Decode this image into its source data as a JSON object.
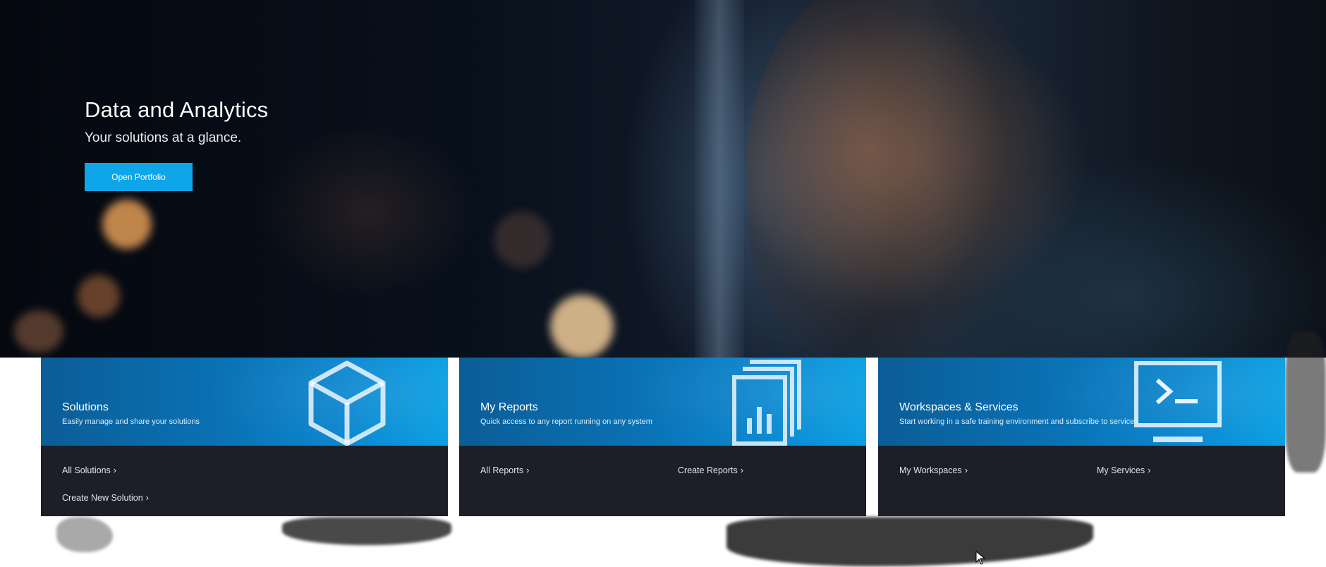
{
  "hero": {
    "title": "Data and Analytics",
    "subtitle": "Your solutions at a glance.",
    "button_label": "Open Portfolio"
  },
  "cards": [
    {
      "title": "Solutions",
      "description": "Easily manage and share your solutions",
      "icon": "cube-icon",
      "links": [
        "All Solutions",
        "Create New Solution"
      ]
    },
    {
      "title": "My Reports",
      "description": "Quick access to any report running on any system",
      "icon": "report-stack-icon",
      "links": [
        "All Reports",
        "Create Reports"
      ]
    },
    {
      "title": "Workspaces & Services",
      "description": "Start working in a safe training environment and subscribe to services",
      "icon": "terminal-monitor-icon",
      "links": [
        "My Workspaces",
        "My Services"
      ]
    }
  ],
  "link_chevron": "›",
  "colors": {
    "accent": "#0ea5e9",
    "card_header": "#0a72b5",
    "card_body": "#1c1e28"
  }
}
